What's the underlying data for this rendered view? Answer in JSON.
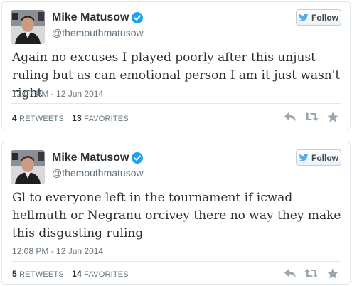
{
  "tweets": [
    {
      "name": "Mike Matusow",
      "handle": "@themouthmatusow",
      "follow_label": "Follow",
      "text": "Again no excuses I played poorly after this unjust ruling but as can emotional person I am it just wasn't right",
      "timestamp": "12:07 PM - 12 Jun 2014",
      "retweets_count": "4",
      "retweets_label": "RETWEETS",
      "favorites_count": "13",
      "favorites_label": "FAVORITES"
    },
    {
      "name": "Mike Matusow",
      "handle": "@themouthmatusow",
      "follow_label": "Follow",
      "text": "Gl to everyone left in the tournament if icwad hellmuth or Negranu orcivey there no way they make this disgusting ruling",
      "timestamp": "12:08 PM - 12 Jun 2014",
      "retweets_count": "5",
      "retweets_label": "RETWEETS",
      "favorites_count": "14",
      "favorites_label": "FAVORITES"
    }
  ],
  "colors": {
    "verified": "#1da1f2",
    "twitter_bird": "#55acee",
    "action_icons": "#9aa5ad"
  },
  "icons": [
    "verified-badge-icon",
    "twitter-bird-icon",
    "reply-icon",
    "retweet-icon",
    "favorite-star-icon"
  ]
}
